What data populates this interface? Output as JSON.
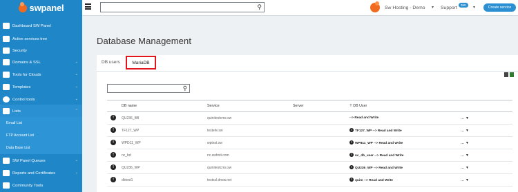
{
  "header": {
    "brand": "swpanel",
    "search": {
      "value": "",
      "placeholder": ""
    },
    "account": "Sw Hosting - Demo",
    "support": "Support",
    "support_badge": "350",
    "create_service": "Create service"
  },
  "sidebar": {
    "items": [
      {
        "label": "Dashboard SW Panel",
        "icon": "dashboard-icon"
      },
      {
        "label": "Active services tree",
        "icon": "tree-icon"
      },
      {
        "label": "Security",
        "icon": "shield-icon"
      },
      {
        "label": "Domains & SSL",
        "icon": "globe-icon"
      },
      {
        "label": "Tools for Clouds",
        "icon": "toolbox-icon"
      },
      {
        "label": "Templates",
        "icon": "template-icon"
      },
      {
        "label": "Control tools",
        "icon": "check-circle-icon"
      },
      {
        "label": "Lists",
        "icon": "list-icon"
      },
      {
        "label": "SW Panel Queues",
        "icon": "queue-icon"
      },
      {
        "label": "Reports and Certificates",
        "icon": "report-icon"
      },
      {
        "label": "Community Tools",
        "icon": "community-icon"
      }
    ],
    "sub_items": [
      "Email List",
      "FTP Account List",
      "Data Base List"
    ]
  },
  "main": {
    "title": "Database Management",
    "tabs": [
      {
        "label": "DB users",
        "active": false
      },
      {
        "label": "MariaDB",
        "active": true
      }
    ],
    "filter": {
      "value": "",
      "placeholder": ""
    },
    "table": {
      "columns": [
        "DB name",
        "Service",
        "Server",
        "DB User"
      ],
      "rows": [
        {
          "name": "QU236_BB",
          "service": "quinitestcms.sw",
          "server": "",
          "user": "",
          "perm": "--> Read and Write",
          "has_user_icon": false
        },
        {
          "name": "TF127_WP",
          "service": "testefe.sw",
          "server": "",
          "user": "TF127_WP",
          "perm": "--> Read and Write",
          "has_user_icon": true
        },
        {
          "name": "WPD11_WP",
          "service": "wptest.sw",
          "server": "",
          "user": "WP811_WP",
          "perm": "--> Read and Write",
          "has_user_icon": true
        },
        {
          "name": "nc_bd",
          "service": "nc.swhnit.com",
          "server": "",
          "user": "nc_db_user",
          "perm": "--> Read and Write",
          "has_user_icon": true
        },
        {
          "name": "QU236_WP",
          "service": "quinitestcms.sw",
          "server": "",
          "user": "QU236_WP",
          "perm": "--> Read and Write",
          "has_user_icon": true
        },
        {
          "name": "dbtest1",
          "service": "testssl.dnsw.net",
          "server": "",
          "user": "quim",
          "perm": "--> Read and Write",
          "has_user_icon": true
        }
      ],
      "row_action": "...",
      "row_action_caret": "▼"
    }
  },
  "colors": {
    "sidebar": "#1f86c8",
    "accent": "#2c8fd1",
    "brand_orange": "#f06a1f",
    "highlight": "#e0161f"
  }
}
